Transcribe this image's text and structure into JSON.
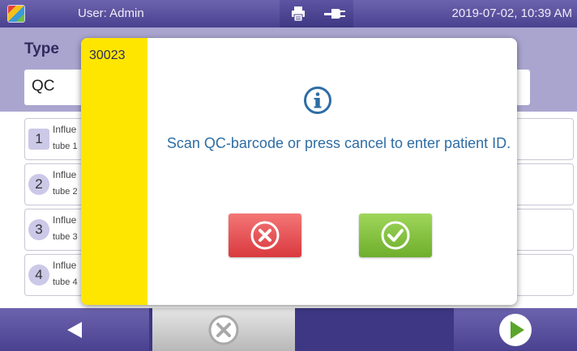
{
  "header": {
    "user": "User: Admin",
    "datetime": "2019-07-02, 10:39 AM",
    "icons": [
      "app-logo-icon",
      "printer-icon",
      "power-plug-icon"
    ]
  },
  "type_panel": {
    "label": "Type",
    "value": "QC"
  },
  "list": [
    {
      "number": "1",
      "title": "Influe",
      "sub": "tube 1"
    },
    {
      "number": "2",
      "title": "Influe",
      "sub": "tube 2"
    },
    {
      "number": "3",
      "title": "Influe",
      "sub": "tube 3"
    },
    {
      "number": "4",
      "title": "Influe",
      "sub": "tube 4"
    }
  ],
  "modal": {
    "code": "30023",
    "message": "Scan QC-barcode or press cancel to enter patient ID.",
    "icon": "info-icon",
    "cancel_icon": "cancel-x-icon",
    "confirm_icon": "confirm-check-icon"
  },
  "footer": {
    "icons": [
      "back-arrow-icon",
      "cancel-x-icon",
      "next-arrow-icon"
    ]
  },
  "colors": {
    "header": "#4a4290",
    "panel": "#aaa5cf",
    "modal_stripe": "#ffe600",
    "message_text": "#2e6da4",
    "cancel_red": "#d9393e",
    "confirm_green": "#6fae2c"
  }
}
